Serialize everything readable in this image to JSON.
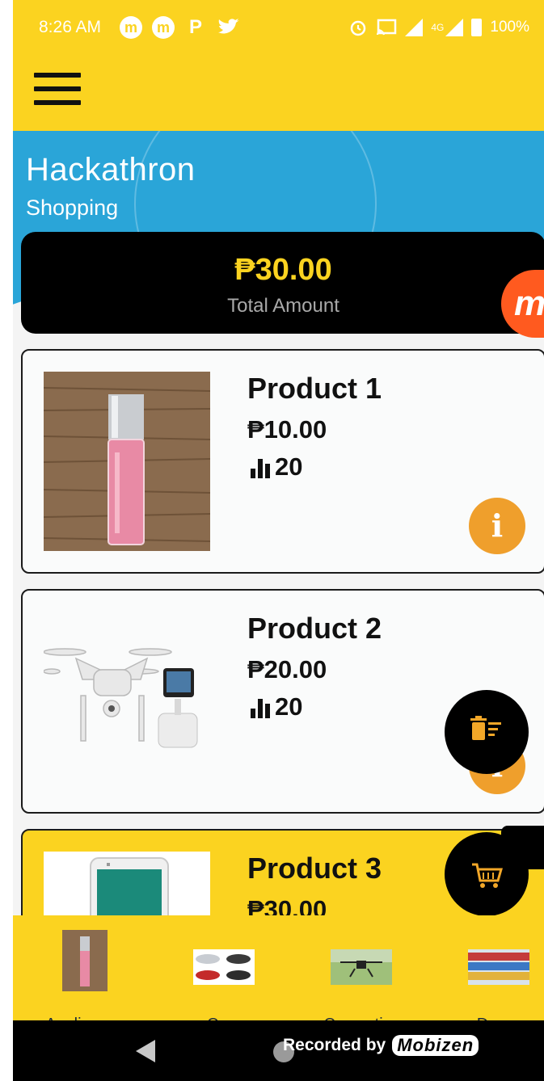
{
  "status_bar": {
    "time": "8:26 AM",
    "battery": "100%",
    "network": "4G",
    "app_icons": [
      "m",
      "m",
      "P"
    ]
  },
  "header": {
    "title": "Hackathron",
    "subtitle": "Shopping"
  },
  "summary": {
    "total_amount": "₱30.00",
    "total_label": "Total Amount"
  },
  "products": [
    {
      "name": "Product 1",
      "price": "₱10.00",
      "stock": "20",
      "image_icon": "lip-gloss-image"
    },
    {
      "name": "Product 2",
      "price": "₱20.00",
      "stock": "20",
      "image_icon": "drone-image"
    },
    {
      "name": "Product 3",
      "price": "₱30.00",
      "stock": "",
      "image_icon": "tablet-image"
    }
  ],
  "categories": [
    {
      "label": "Appliances",
      "icon": "lip-gloss-thumb"
    },
    {
      "label": "Cars",
      "icon": "cars-thumb"
    },
    {
      "label": "Cosmetics",
      "icon": "drone-thumb"
    },
    {
      "label": "Drone",
      "icon": "store-shelf-thumb"
    }
  ],
  "recorder": {
    "text": "Recorded by",
    "brand": "Mobizen"
  },
  "colors": {
    "accent_yellow": "#fbd320",
    "header_blue": "#2aa5d8",
    "info_orange": "#ef9f2c",
    "badge_orange": "#ff5a1f"
  }
}
